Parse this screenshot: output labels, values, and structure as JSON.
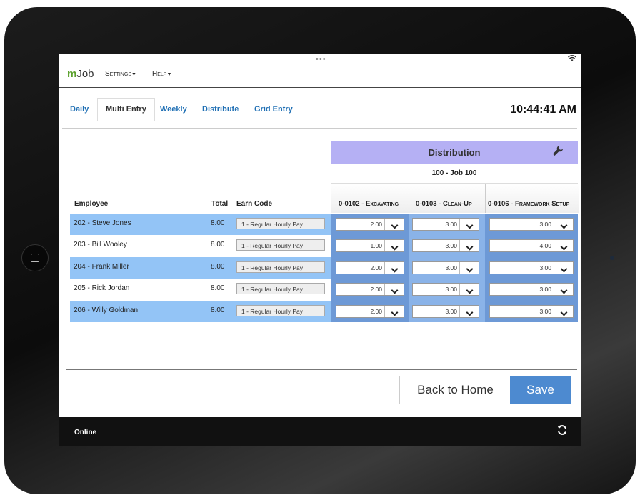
{
  "app": {
    "logo_m": "m",
    "logo_rest": "Job"
  },
  "menu": {
    "settings": "Settings",
    "help": "Help"
  },
  "tabs": [
    {
      "label": "Daily"
    },
    {
      "label": "Multi Entry"
    },
    {
      "label": "Weekly"
    },
    {
      "label": "Distribute"
    },
    {
      "label": "Grid Entry"
    }
  ],
  "clock": "10:44:41 AM",
  "distribution": {
    "title": "Distribution",
    "job": "100 - Job 100"
  },
  "columns": {
    "employee": "Employee",
    "total": "Total",
    "earn_code": "Earn Code",
    "job1": "0-0102 - Excavating",
    "job2": "0-0103 - Clean-Up",
    "job3": "0-0106 - Framework Setup"
  },
  "rows": [
    {
      "employee": "202 - Steve Jones",
      "total": "8.00",
      "earn": "1 - Regular Hourly Pay",
      "v1": "2.00",
      "v2": "3.00",
      "v3": "3.00"
    },
    {
      "employee": "203 - Bill Wooley",
      "total": "8.00",
      "earn": "1 - Regular Hourly Pay",
      "v1": "1.00",
      "v2": "3.00",
      "v3": "4.00"
    },
    {
      "employee": "204 - Frank Miller",
      "total": "8.00",
      "earn": "1 - Regular Hourly Pay",
      "v1": "2.00",
      "v2": "3.00",
      "v3": "3.00"
    },
    {
      "employee": "205 - Rick Jordan",
      "total": "8.00",
      "earn": "1 - Regular Hourly Pay",
      "v1": "2.00",
      "v2": "3.00",
      "v3": "3.00"
    },
    {
      "employee": "206 - Willy Goldman",
      "total": "8.00",
      "earn": "1 - Regular Hourly Pay",
      "v1": "2.00",
      "v2": "3.00",
      "v3": "3.00"
    }
  ],
  "buttons": {
    "back": "Back to Home",
    "save": "Save"
  },
  "footer": {
    "status": "Online"
  },
  "icons": {
    "wrench": "wrench-icon",
    "sync": "sync-icon",
    "wifi": "wifi-icon"
  },
  "colors": {
    "accent": "#4d8ad0",
    "row_highlight": "#93c4f6",
    "distribution_header": "#b5b0f4",
    "brand_green": "#5aa02c"
  }
}
